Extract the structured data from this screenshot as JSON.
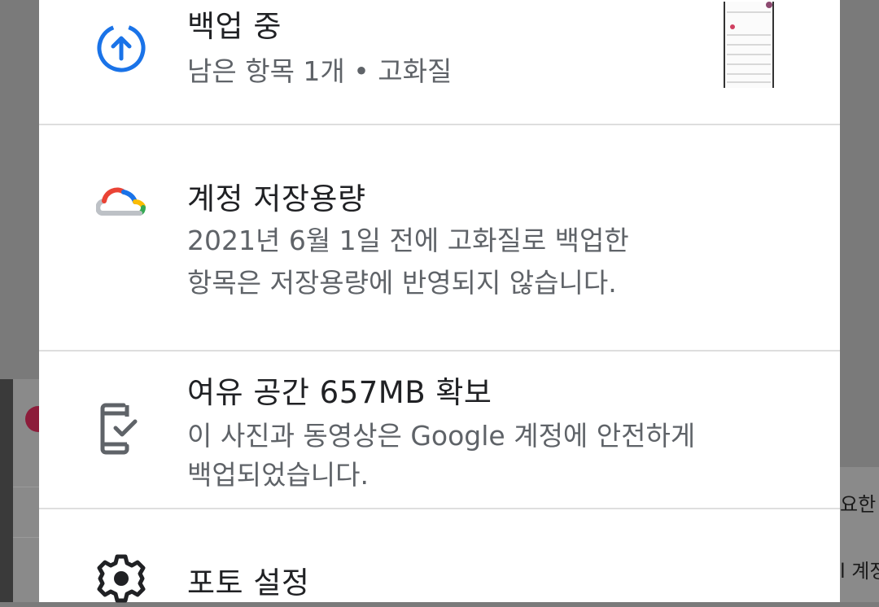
{
  "sheet": {
    "items": [
      {
        "title": "백업 중",
        "subtitle": "남은 항목 1개  •  고화질",
        "icon": "backup-upload-icon"
      },
      {
        "title": "계정 저장용량",
        "subtitle_lines": [
          "2021년 6월 1일 전에 고화질로 백업한",
          "항목은 저장용량에 반영되지 않습니다."
        ],
        "icon": "google-cloud-icon"
      },
      {
        "title": "여유 공간 657MB 확보",
        "subtitle_lines": [
          "이 사진과 동영상은 Google 계정에 안전하게",
          "백업되었습니다."
        ],
        "icon": "phone-check-icon"
      },
      {
        "title": "포토 설정",
        "icon": "gear-icon"
      }
    ]
  },
  "background": {
    "right_text_1": "요한",
    "right_text_2": "l 계정"
  },
  "colors": {
    "accent_blue": "#1a73e8",
    "google_red": "#ea4335",
    "google_yellow": "#fbbc04",
    "google_green": "#34a853"
  }
}
